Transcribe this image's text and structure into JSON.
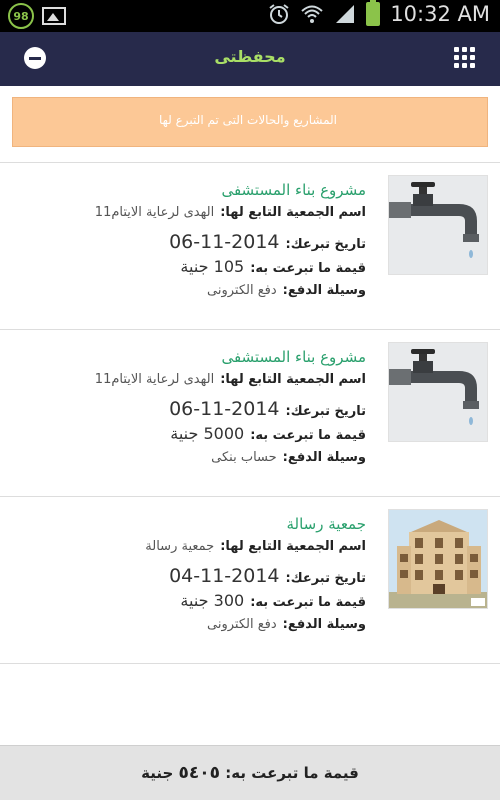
{
  "status_bar": {
    "battery_percent": "98",
    "time": "10:32 AM",
    "icons": [
      "gallery-icon",
      "alarm-icon",
      "wifi-icon",
      "signal-icon",
      "battery-icon"
    ]
  },
  "header": {
    "title": "محفظتى",
    "left_icon": "minus-circle-icon",
    "right_icon": "grid-menu-icon"
  },
  "banner": {
    "text": "المشاريع والحالات التى تم التبرع لها"
  },
  "donations": [
    {
      "title": "مشروع بناء المستشفى",
      "org_label": "اسم الجمعية التابع لها:",
      "org_value": "الهدى لرعاية الايتام11",
      "date_label": "تاريخ تبرعك:",
      "date_value": "06-11-2014",
      "amount_label": "قيمة ما تبرعت به:",
      "amount_value": "105 جنية",
      "method_label": "وسيلة الدفع:",
      "method_value": "دفع الكترونى",
      "image": "water-tap-image"
    },
    {
      "title": "مشروع بناء المستشفى",
      "org_label": "اسم الجمعية التابع لها:",
      "org_value": "الهدى لرعاية الايتام11",
      "date_label": "تاريخ تبرعك:",
      "date_value": "06-11-2014",
      "amount_label": "قيمة ما تبرعت به:",
      "amount_value": "5000 جنية",
      "method_label": "وسيلة الدفع:",
      "method_value": "حساب بنكى",
      "image": "water-tap-image"
    },
    {
      "title": "جمعية رسالة",
      "org_label": "اسم الجمعية التابع لها:",
      "org_value": "جمعية رسالة",
      "date_label": "تاريخ تبرعك:",
      "date_value": "04-11-2014",
      "amount_label": "قيمة ما تبرعت به:",
      "amount_value": "300 جنية",
      "method_label": "وسيلة الدفع:",
      "method_value": "دفع الكترونى",
      "image": "building-image"
    }
  ],
  "footer": {
    "label": "قيمة ما تبرعت به:",
    "amount": "٥٤٠٥",
    "currency": "جنية"
  },
  "colors": {
    "header_bg": "#272a4b",
    "header_title": "#a9df66",
    "banner_bg": "#fcc896",
    "item_title": "#2aa06d",
    "footer_bg": "#e3e3e3"
  }
}
